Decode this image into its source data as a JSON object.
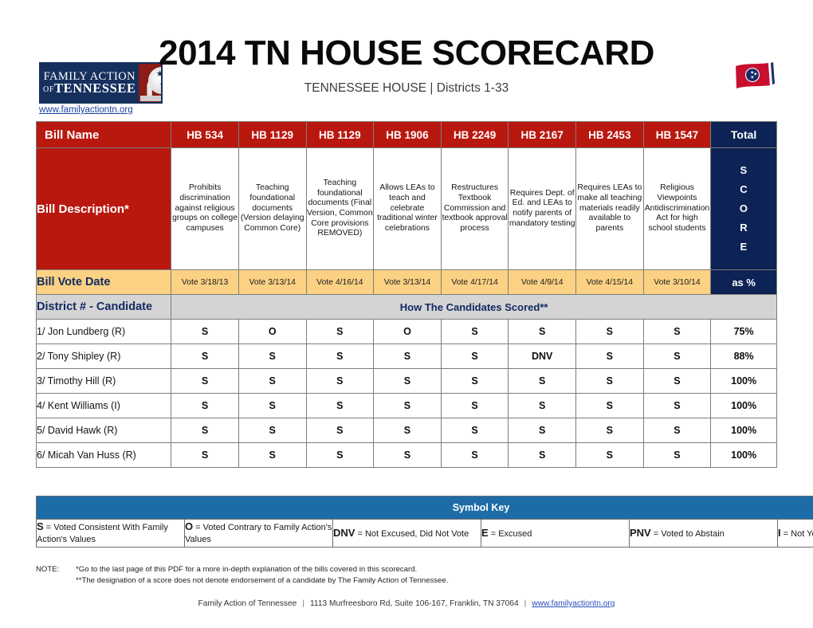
{
  "header": {
    "title": "2014 TN HOUSE SCORECARD",
    "subtitle": "TENNESSEE HOUSE | Districts 1-33",
    "logo": {
      "line1": "FAMILY ACTION",
      "line2_prefix": "OF",
      "line2": "TENNESSEE",
      "emblem": "tn-capitol-tristar-emblem"
    },
    "site_url": "www.familyactiontn.org",
    "flag_icon": "tennessee-flag-icon"
  },
  "table": {
    "row_labels": {
      "bill_name": "Bill Name",
      "bill_description": "Bill Description*",
      "bill_vote_date": "Bill Vote Date",
      "district_candidate": "District # - Candidate"
    },
    "total_header": "Total",
    "score_letters": "S\nC\nO\nR\nE",
    "as_percent": "as %",
    "scored_banner": "How The Candidates Scored**",
    "bills": [
      {
        "name": "HB 534",
        "description": "Prohibits discrimination against religious groups on college campuses",
        "vote_date": "Vote 3/18/13"
      },
      {
        "name": "HB 1129",
        "description": "Teaching foundational documents (Version delaying Common Core)",
        "vote_date": "Vote 3/13/14"
      },
      {
        "name": "HB 1129",
        "description": "Teaching foundational documents (Final Version, Common Core provisions REMOVED)",
        "vote_date": "Vote 4/16/14"
      },
      {
        "name": "HB 1906",
        "description": "Allows LEAs to teach and celebrate traditional winter celebrations",
        "vote_date": "Vote 3/13/14"
      },
      {
        "name": "HB 2249",
        "description": "Restructures Textbook Commission and textbook approval process",
        "vote_date": "Vote 4/17/14"
      },
      {
        "name": "HB 2167",
        "description": "Requires Dept. of Ed. and LEAs to notify parents of mandatory testing",
        "vote_date": "Vote 4/9/14"
      },
      {
        "name": "HB 2453",
        "description": "Requires LEAs to make all teaching materials readily available to parents",
        "vote_date": "Vote 4/15/14"
      },
      {
        "name": "HB 1547",
        "description": "Religious Viewpoints Antidiscrimination Act for high school students",
        "vote_date": "Vote 3/10/14"
      }
    ],
    "candidates": [
      {
        "candidate": "1/ Jon Lundberg (R)",
        "votes": [
          "S",
          "O",
          "S",
          "O",
          "S",
          "S",
          "S",
          "S"
        ],
        "total": "75%"
      },
      {
        "candidate": "2/ Tony Shipley (R)",
        "votes": [
          "S",
          "S",
          "S",
          "S",
          "S",
          "DNV",
          "S",
          "S"
        ],
        "total": "88%"
      },
      {
        "candidate": "3/ Timothy Hill (R)",
        "votes": [
          "S",
          "S",
          "S",
          "S",
          "S",
          "S",
          "S",
          "S"
        ],
        "total": "100%"
      },
      {
        "candidate": "4/ Kent Williams (I)",
        "votes": [
          "S",
          "S",
          "S",
          "S",
          "S",
          "S",
          "S",
          "S"
        ],
        "total": "100%"
      },
      {
        "candidate": "5/ David Hawk (R)",
        "votes": [
          "S",
          "S",
          "S",
          "S",
          "S",
          "S",
          "S",
          "S"
        ],
        "total": "100%"
      },
      {
        "candidate": "6/ Micah Van Huss (R)",
        "votes": [
          "S",
          "S",
          "S",
          "S",
          "S",
          "S",
          "S",
          "S"
        ],
        "total": "100%"
      }
    ]
  },
  "symbol_key": {
    "title": "Symbol Key",
    "entries": [
      {
        "symbol": "S",
        "definition": " = Voted Consistent With Family Action's Values"
      },
      {
        "symbol": "O",
        "definition": " = Voted Contrary to Family Action's Values"
      },
      {
        "symbol": "DNV",
        "definition": " = Not Excused, Did Not Vote"
      },
      {
        "symbol": "E",
        "definition": " = Excused"
      },
      {
        "symbol": "PNV",
        "definition": " = Voted to Abstain"
      },
      {
        "symbol": "I",
        "definition": " = Not Yet Seated"
      }
    ]
  },
  "notes": {
    "label": "NOTE:",
    "line1": "*Go to the last page of this PDF for a more in-depth explanation of the bills covered in this scorecard.",
    "line2": "**The designation of a score does not denote endorsement of a candidate by The Family Action of Tennessee."
  },
  "footer": {
    "org": "Family Action of Tennessee",
    "address": "1113 Murfreesboro Rd, Suite 106-167, Franklin, TN 37064",
    "url": "www.familyactiontn.org"
  },
  "colors": {
    "red": "#b9180f",
    "navy": "#0d2356",
    "yellow": "#fbd184",
    "gray_band": "#d4d4d4",
    "key_blue": "#1d6ca7",
    "link": "#2a4fbf"
  }
}
